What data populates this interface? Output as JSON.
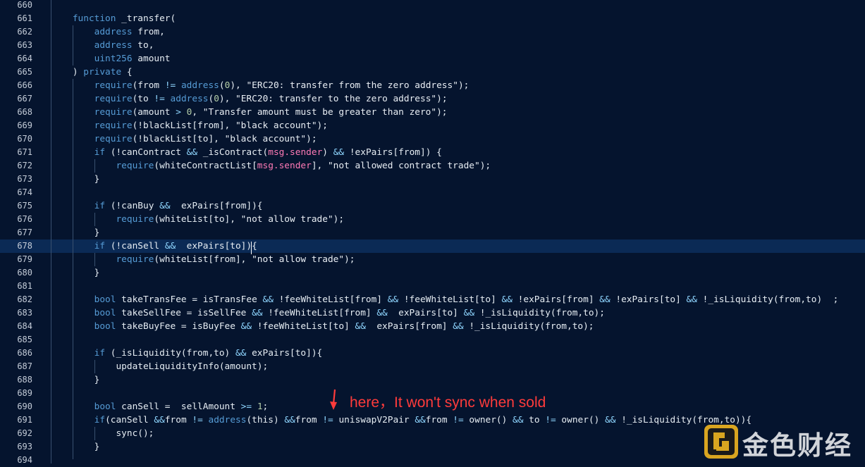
{
  "editor": {
    "lines": [
      {
        "num": "660",
        "text": ""
      },
      {
        "num": "661",
        "text": "    function _transfer("
      },
      {
        "num": "662",
        "text": "        address from,"
      },
      {
        "num": "663",
        "text": "        address to,"
      },
      {
        "num": "664",
        "text": "        uint256 amount"
      },
      {
        "num": "665",
        "text": "    ) private {"
      },
      {
        "num": "666",
        "text": "        require(from != address(0), \"ERC20: transfer from the zero address\");"
      },
      {
        "num": "667",
        "text": "        require(to != address(0), \"ERC20: transfer to the zero address\");"
      },
      {
        "num": "668",
        "text": "        require(amount > 0, \"Transfer amount must be greater than zero\");"
      },
      {
        "num": "669",
        "text": "        require(!blackList[from], \"black account\");"
      },
      {
        "num": "670",
        "text": "        require(!blackList[to], \"black account\");"
      },
      {
        "num": "671",
        "text": "        if (!canContract && _isContract(msg.sender) && !exPairs[from]) {"
      },
      {
        "num": "672",
        "text": "            require(whiteContractList[msg.sender], \"not allowed contract trade\");"
      },
      {
        "num": "673",
        "text": "        }"
      },
      {
        "num": "674",
        "text": ""
      },
      {
        "num": "675",
        "text": "        if (!canBuy &&  exPairs[from]){"
      },
      {
        "num": "676",
        "text": "            require(whiteList[to], \"not allow trade\");"
      },
      {
        "num": "677",
        "text": "        }"
      },
      {
        "num": "678",
        "text": "        if (!canSell &&  exPairs[to]){"
      },
      {
        "num": "679",
        "text": "            require(whiteList[from], \"not allow trade\");"
      },
      {
        "num": "680",
        "text": "        }"
      },
      {
        "num": "681",
        "text": ""
      },
      {
        "num": "682",
        "text": "        bool takeTransFee = isTransFee && !feeWhiteList[from] && !feeWhiteList[to] && !exPairs[from] && !exPairs[to] && !_isLiquidity(from,to)  ;"
      },
      {
        "num": "683",
        "text": "        bool takeSellFee = isSellFee && !feeWhiteList[from] &&  exPairs[to] && !_isLiquidity(from,to);"
      },
      {
        "num": "684",
        "text": "        bool takeBuyFee = isBuyFee && !feeWhiteList[to] &&  exPairs[from] && !_isLiquidity(from,to);"
      },
      {
        "num": "685",
        "text": ""
      },
      {
        "num": "686",
        "text": "        if (_isLiquidity(from,to) && exPairs[to]){"
      },
      {
        "num": "687",
        "text": "            updateLiquidityInfo(amount);"
      },
      {
        "num": "688",
        "text": "        }"
      },
      {
        "num": "689",
        "text": ""
      },
      {
        "num": "690",
        "text": "        bool canSell =  sellAmount >= 1;"
      },
      {
        "num": "691",
        "text": "        if(canSell &&from != address(this) &&from != uniswapV2Pair &&from != owner() && to != owner() && !_isLiquidity(from,to)){"
      },
      {
        "num": "692",
        "text": "            sync();"
      },
      {
        "num": "693",
        "text": "        }"
      },
      {
        "num": "694",
        "text": ""
      }
    ],
    "highlighted_line": "678"
  },
  "annotation": {
    "text": "here，It won't sync when sold",
    "color": "#ff3b3b"
  },
  "watermark": {
    "text": "金色财经",
    "icon": "jinse-logo-icon"
  }
}
